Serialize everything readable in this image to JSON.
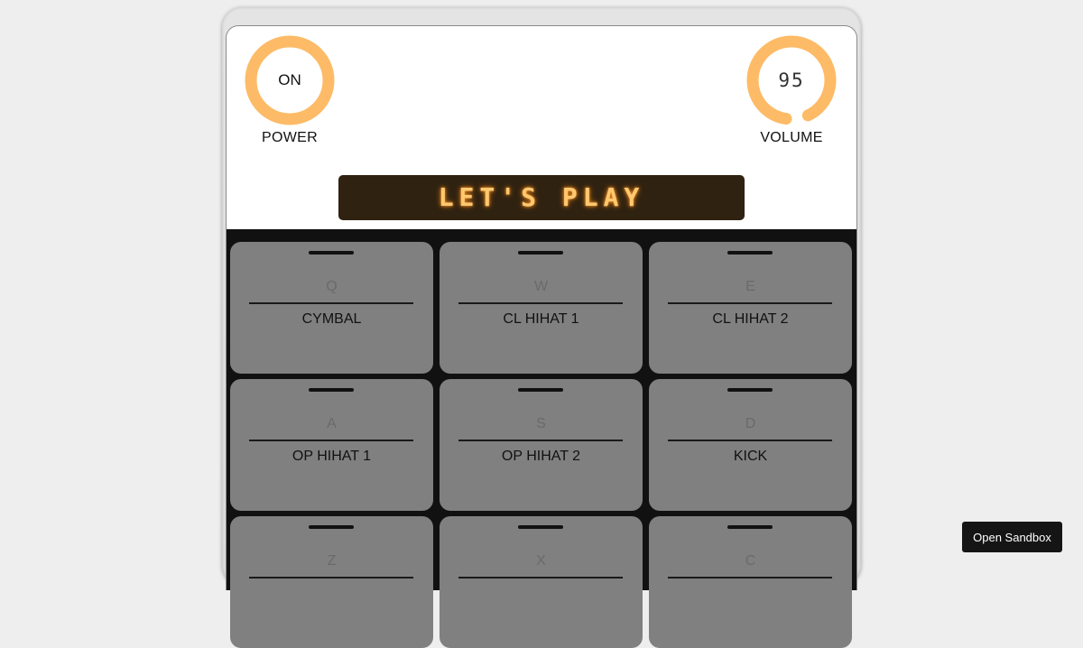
{
  "power": {
    "label": "POWER",
    "value": "ON"
  },
  "volume": {
    "label": "VOLUME",
    "value": "95",
    "level": 0.95
  },
  "display": {
    "text": "LET'S PLAY"
  },
  "pads": [
    {
      "key": "Q",
      "name": "CYMBAL"
    },
    {
      "key": "W",
      "name": "CL HIHAT 1"
    },
    {
      "key": "E",
      "name": "CL HIHAT 2"
    },
    {
      "key": "A",
      "name": "OP HIHAT 1"
    },
    {
      "key": "S",
      "name": "OP HIHAT 2"
    },
    {
      "key": "D",
      "name": "KICK"
    },
    {
      "key": "Z",
      "name": ""
    },
    {
      "key": "X",
      "name": ""
    },
    {
      "key": "C",
      "name": ""
    }
  ],
  "sandbox": {
    "label": "Open Sandbox"
  },
  "colors": {
    "knob_ring": "#fdbb67",
    "display_bg": "#2f2211",
    "display_text": "#ffc870",
    "pad": "#808080",
    "pads_bg": "#111111"
  }
}
